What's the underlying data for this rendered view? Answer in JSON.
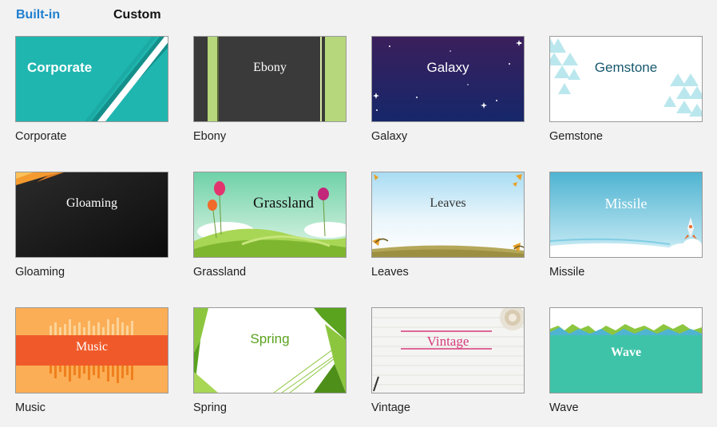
{
  "tabs": {
    "builtin": "Built-in",
    "custom": "Custom"
  },
  "themes": [
    {
      "title": "Corporate",
      "caption": "Corporate"
    },
    {
      "title": "Ebony",
      "caption": "Ebony"
    },
    {
      "title": "Galaxy",
      "caption": "Galaxy"
    },
    {
      "title": "Gemstone",
      "caption": "Gemstone"
    },
    {
      "title": "Gloaming",
      "caption": "Gloaming"
    },
    {
      "title": "Grassland",
      "caption": "Grassland"
    },
    {
      "title": "Leaves",
      "caption": "Leaves"
    },
    {
      "title": "Missile",
      "caption": "Missile"
    },
    {
      "title": "Music",
      "caption": "Music"
    },
    {
      "title": "Spring",
      "caption": "Spring"
    },
    {
      "title": "Vintage",
      "caption": "Vintage"
    },
    {
      "title": "Wave",
      "caption": "Wave"
    }
  ],
  "colors": {
    "tab_active": "#1e7fd0",
    "corporate": "#20b6b0",
    "ebony": "#3a3a3a",
    "galaxy": "#2a2660",
    "gemstone": "#17586e",
    "gloaming": "#1a1a1a",
    "grassland": "#8cc63f",
    "missile": "#5bb8d4",
    "music": "#f26b3a",
    "spring": "#5aa31e",
    "vintage": "#d6397a",
    "wave": "#3fc3a8"
  }
}
